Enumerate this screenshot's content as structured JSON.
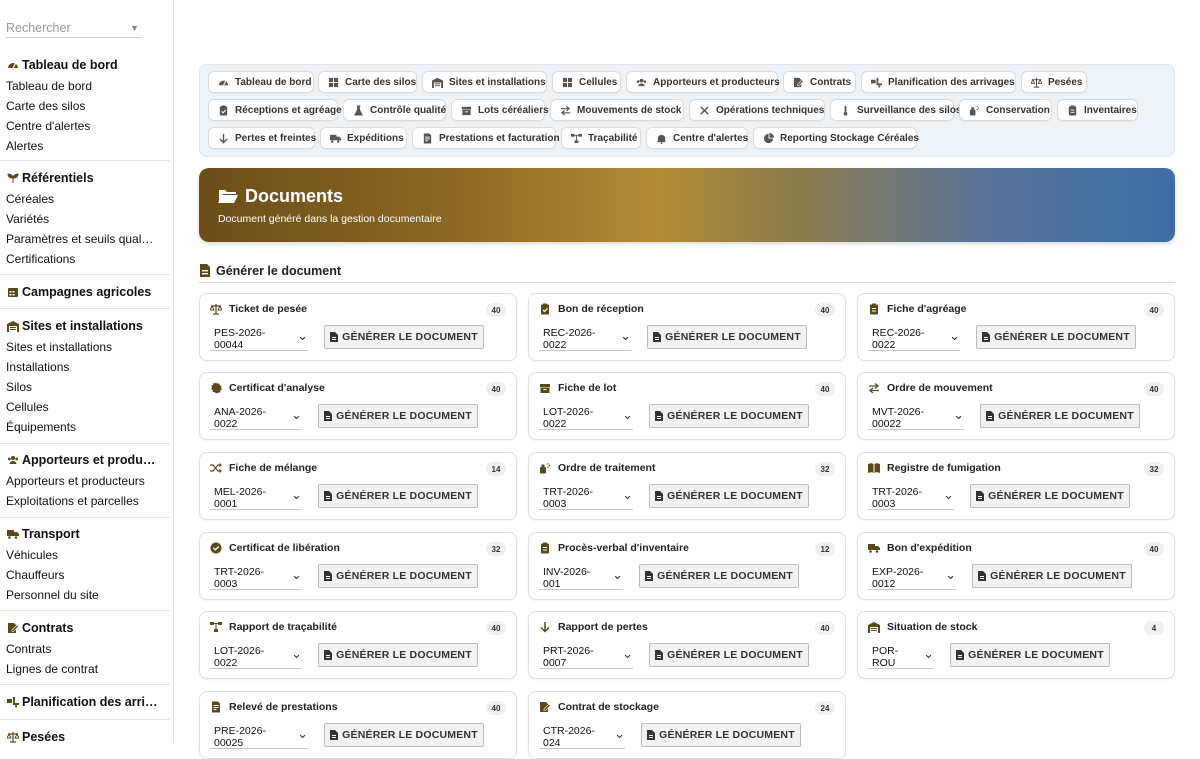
{
  "search": {
    "placeholder": "Rechercher"
  },
  "sidebar": {
    "sections": [
      {
        "title": "Tableau de bord",
        "icon": "dashboard-icon",
        "items": [
          "Tableau de bord",
          "Carte des silos",
          "Centre d'alertes",
          "Alertes"
        ]
      },
      {
        "title": "Référentiels",
        "icon": "seedling-icon",
        "items": [
          "Céréales",
          "Variétés",
          "Paramètres et seuils qual…",
          "Certifications"
        ]
      },
      {
        "title": "Campagnes agricoles",
        "icon": "calendar-icon",
        "items": []
      },
      {
        "title": "Sites et installations",
        "icon": "warehouse-icon",
        "items": [
          "Sites et installations",
          "Installations",
          "Silos",
          "Cellules",
          "Équipements"
        ]
      },
      {
        "title": "Apporteurs et produ…",
        "icon": "users-icon",
        "items": [
          "Apporteurs et producteurs",
          "Exploitations et parcelles"
        ]
      },
      {
        "title": "Transport",
        "icon": "truck-icon",
        "items": [
          "Véhicules",
          "Chauffeurs",
          "Personnel du site"
        ]
      },
      {
        "title": "Contrats",
        "icon": "contract-icon",
        "items": [
          "Contrats",
          "Lignes de contrat"
        ]
      },
      {
        "title": "Planification des arri…",
        "icon": "truck-loading-icon",
        "items": []
      },
      {
        "title": "Pesées",
        "icon": "scale-icon",
        "items": []
      }
    ]
  },
  "tabs": [
    {
      "label": "Tableau de bord",
      "icon": "dashboard-icon"
    },
    {
      "label": "Carte des silos",
      "icon": "grid-icon"
    },
    {
      "label": "Sites et installations",
      "icon": "warehouse-icon"
    },
    {
      "label": "Cellules",
      "icon": "grid-icon"
    },
    {
      "label": "Apporteurs et producteurs",
      "icon": "users-icon"
    },
    {
      "label": "Contrats",
      "icon": "contract-icon"
    },
    {
      "label": "Planification des arrivages",
      "icon": "truck-loading-icon"
    },
    {
      "label": "Pesées",
      "icon": "scale-icon"
    },
    {
      "label": "Réceptions et agréage",
      "icon": "clipboard-check-icon"
    },
    {
      "label": "Contrôle qualité",
      "icon": "flask-icon"
    },
    {
      "label": "Lots céréaliers",
      "icon": "box-icon"
    },
    {
      "label": "Mouvements de stock",
      "icon": "exchange-icon"
    },
    {
      "label": "Opérations techniques",
      "icon": "tools-icon"
    },
    {
      "label": "Surveillance des silos",
      "icon": "thermometer-icon"
    },
    {
      "label": "Conservation",
      "icon": "spray-icon"
    },
    {
      "label": "Inventaires",
      "icon": "clipboard-list-icon"
    },
    {
      "label": "Pertes et freintes",
      "icon": "arrow-down-icon"
    },
    {
      "label": "Expéditions",
      "icon": "truck-icon"
    },
    {
      "label": "Prestations et facturation",
      "icon": "invoice-icon"
    },
    {
      "label": "Traçabilité",
      "icon": "sitemap-icon"
    },
    {
      "label": "Centre d'alertes",
      "icon": "bell-icon"
    },
    {
      "label": "Reporting Stockage Céréales",
      "icon": "chart-pie-icon"
    }
  ],
  "banner": {
    "title": "Documents",
    "subtitle": "Document généré dans la gestion documentaire",
    "gradient_colors": [
      "#6b4d18",
      "#b08c34",
      "#3c6ea8"
    ]
  },
  "section": {
    "title": "Générer le document"
  },
  "generate_label": "GÉNÉRER LE DOCUMENT",
  "cards": [
    {
      "title": "Ticket de pesée",
      "icon": "scale-icon",
      "count": "40",
      "selected": "PES-2026-00044"
    },
    {
      "title": "Bon de réception",
      "icon": "clipboard-check-icon",
      "count": "40",
      "selected": "REC-2026-0022"
    },
    {
      "title": "Fiche d'agréage",
      "icon": "clipboard-list-icon",
      "count": "40",
      "selected": "REC-2026-0022"
    },
    {
      "title": "Certificat d'analyse",
      "icon": "certificate-icon",
      "count": "40",
      "selected": "ANA-2026-0022"
    },
    {
      "title": "Fiche de lot",
      "icon": "box-icon",
      "count": "40",
      "selected": "LOT-2026-0022"
    },
    {
      "title": "Ordre de mouvement",
      "icon": "exchange-icon",
      "count": "40",
      "selected": "MVT-2026-00022"
    },
    {
      "title": "Fiche de mélange",
      "icon": "shuffle-icon",
      "count": "14",
      "selected": "MEL-2026-0001"
    },
    {
      "title": "Ordre de traitement",
      "icon": "spray-icon",
      "count": "32",
      "selected": "TRT-2026-0003"
    },
    {
      "title": "Registre de fumigation",
      "icon": "book-icon",
      "count": "32",
      "selected": "TRT-2026-0003"
    },
    {
      "title": "Certificat de libération",
      "icon": "check-circle-icon",
      "count": "32",
      "selected": "TRT-2026-0003"
    },
    {
      "title": "Procès-verbal d'inventaire",
      "icon": "clipboard-list-icon",
      "count": "12",
      "selected": "INV-2026-001"
    },
    {
      "title": "Bon d'expédition",
      "icon": "truck-icon",
      "count": "40",
      "selected": "EXP-2026-0012"
    },
    {
      "title": "Rapport de traçabilité",
      "icon": "sitemap-icon",
      "count": "40",
      "selected": "LOT-2026-0022"
    },
    {
      "title": "Rapport de pertes",
      "icon": "arrow-down-icon",
      "count": "40",
      "selected": "PRT-2026-0007"
    },
    {
      "title": "Situation de stock",
      "icon": "warehouse-icon",
      "count": "4",
      "selected": "POR-ROU"
    },
    {
      "title": "Relevé de prestations",
      "icon": "invoice-icon",
      "count": "40",
      "selected": "PRE-2026-00025"
    },
    {
      "title": "Contrat de stockage",
      "icon": "contract-icon",
      "count": "24",
      "selected": "CTR-2026-024"
    }
  ]
}
